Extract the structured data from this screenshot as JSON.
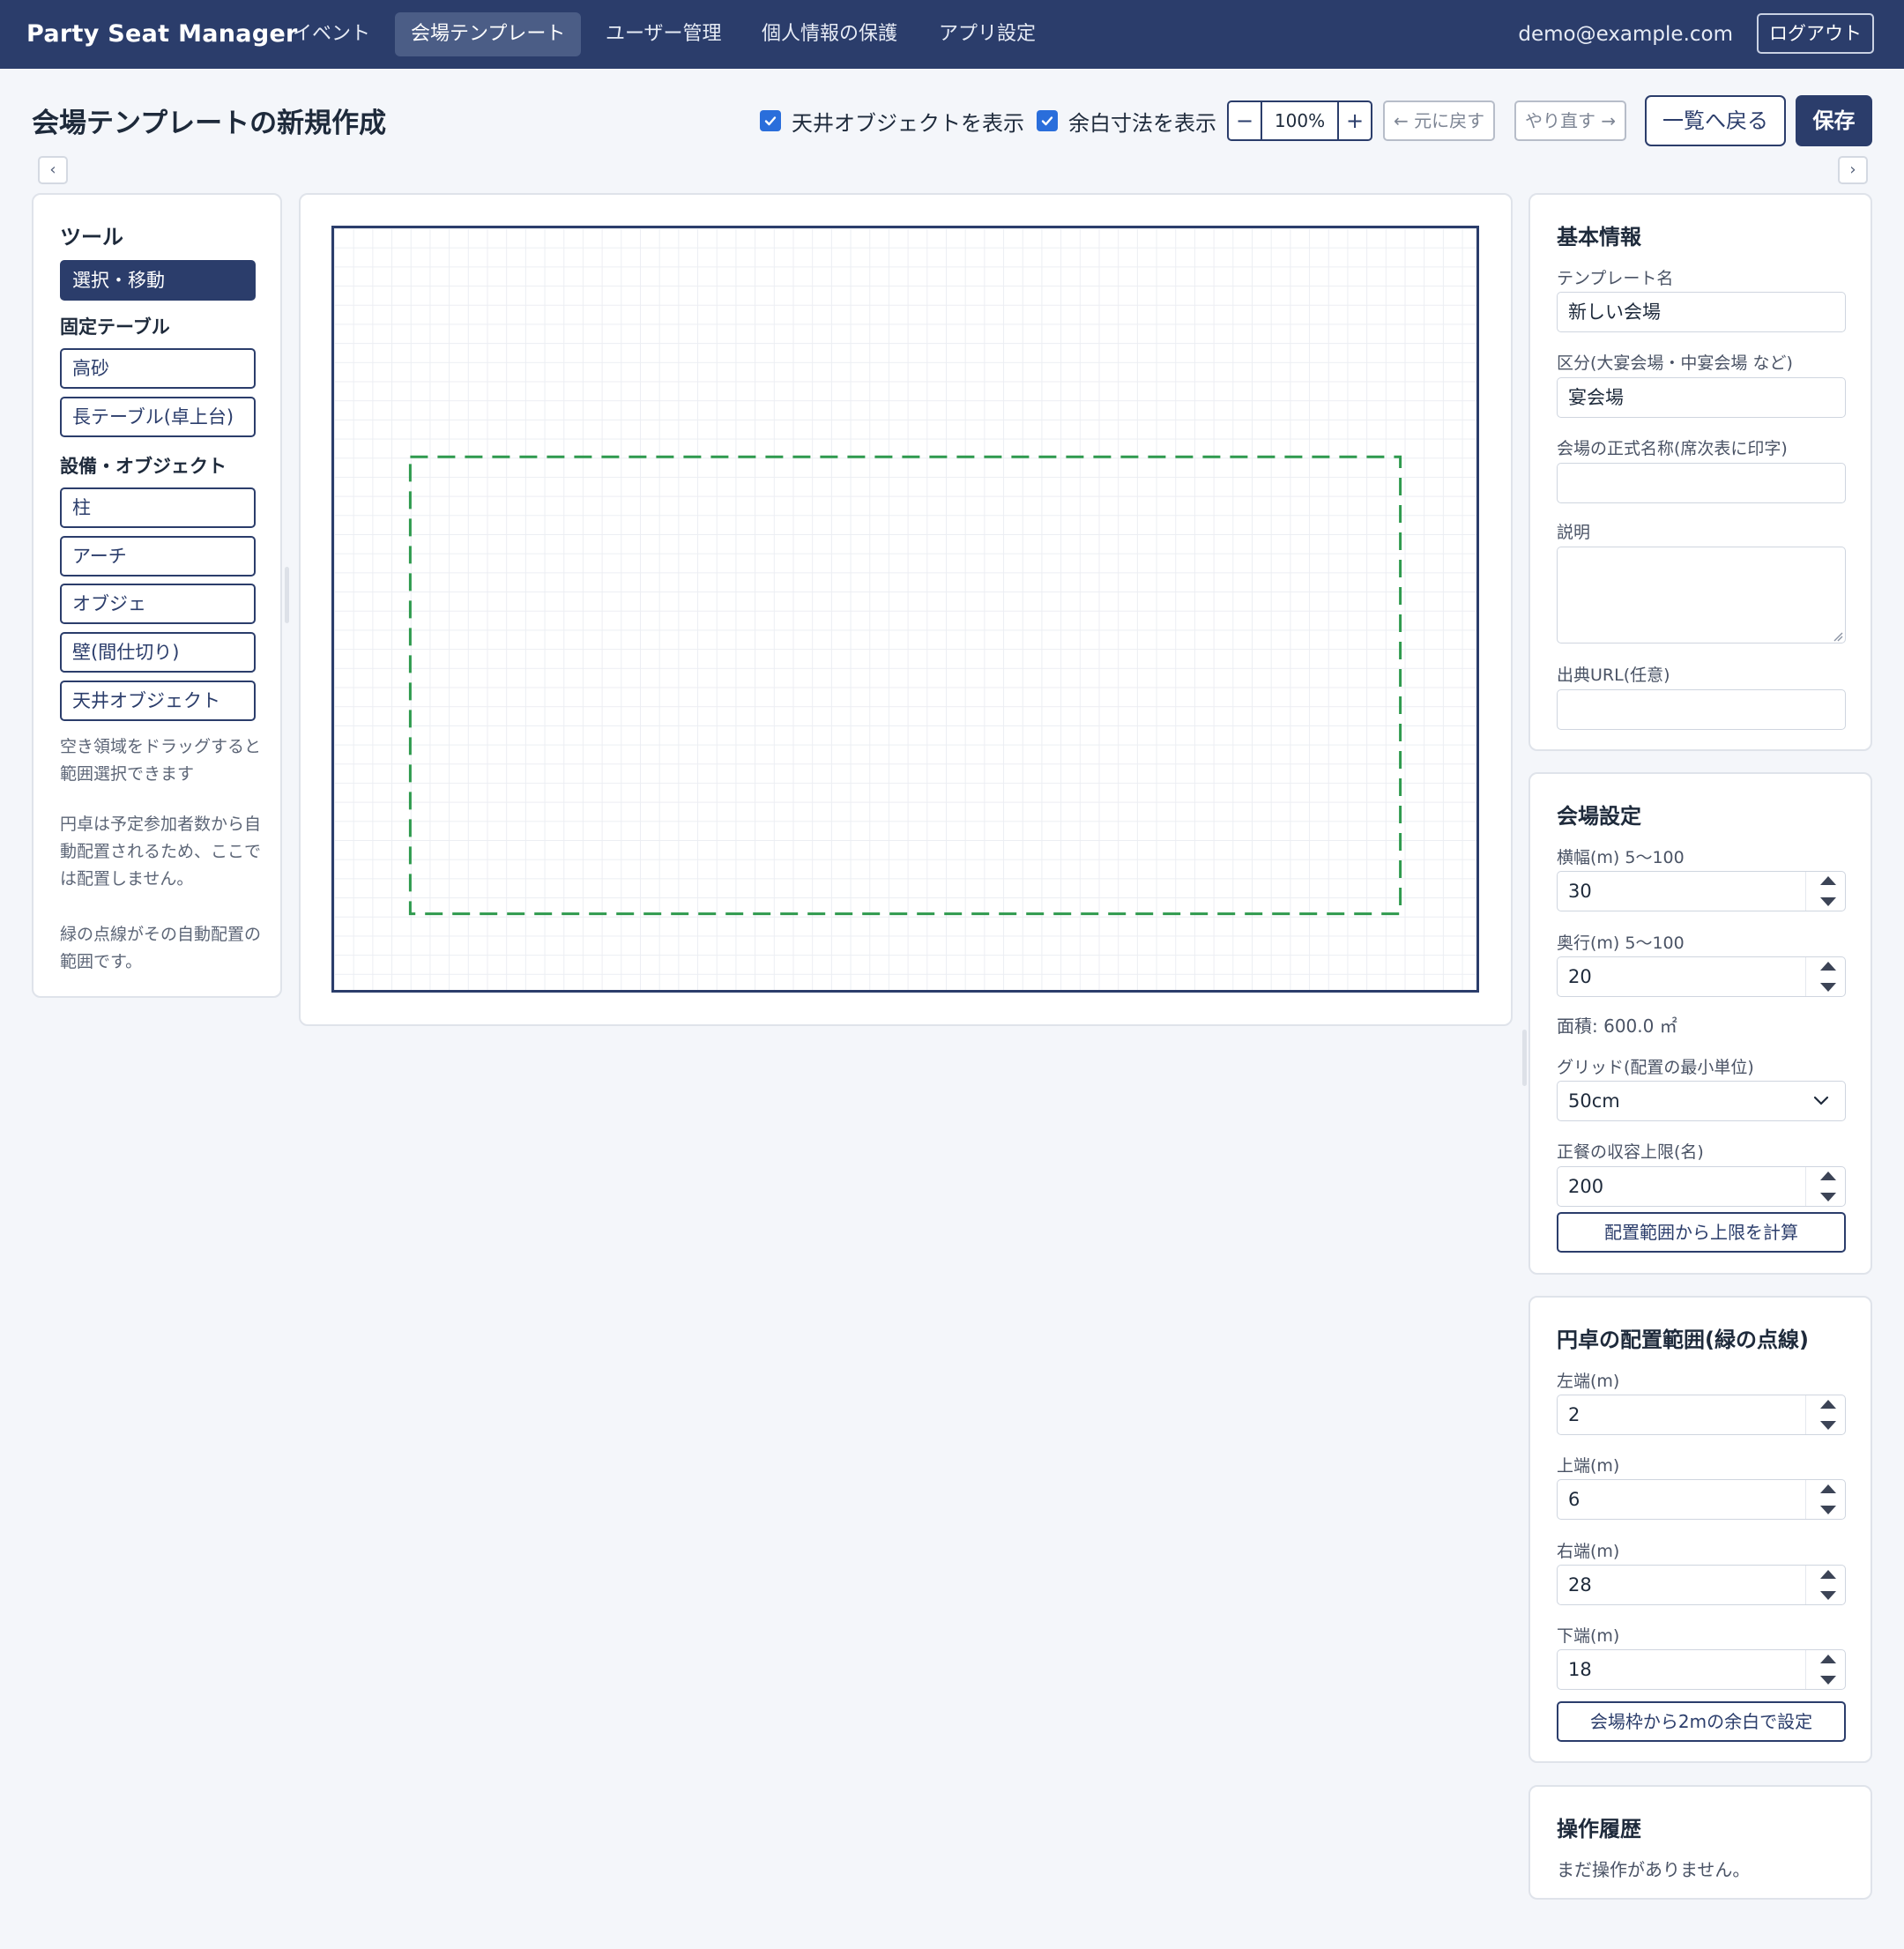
{
  "nav": {
    "brand": "Party Seat Manager",
    "items": [
      {
        "label": "イベント"
      },
      {
        "label": "会場テンプレート"
      },
      {
        "label": "ユーザー管理"
      },
      {
        "label": "個人情報の保護"
      },
      {
        "label": "アプリ設定"
      }
    ],
    "active_index": 1,
    "email": "demo@example.com",
    "logout_label": "ログアウト"
  },
  "header": {
    "title": "会場テンプレートの新規作成",
    "show_ceiling_label": "天井オブジェクトを表示",
    "show_ceiling_checked": true,
    "show_margin_label": "余白寸法を表示",
    "show_margin_checked": true,
    "zoom_minus": "−",
    "zoom_value": "100%",
    "zoom_plus": "+",
    "undo_label": "← 元に戻す",
    "redo_label": "やり直す →",
    "back_label": "一覧へ戻る",
    "save_label": "保存",
    "collapse_left": "‹",
    "collapse_right": "›"
  },
  "tools": {
    "title": "ツール",
    "select_label": "選択・移動",
    "fixed_tables_title": "固定テーブル",
    "fixed_tables": [
      "高砂",
      "長テーブル(卓上台)"
    ],
    "objects_title": "設備・オブジェクト",
    "objects": [
      "柱",
      "アーチ",
      "オブジェ",
      "壁(間仕切り)",
      "天井オブジェクト"
    ],
    "help_drag": "空き領域をドラッグすると範囲選択できます",
    "help_round_1": "円卓は予定参加者数から自動配置されるため、ここでは配置しません。",
    "help_round_2": "緑の点線がその自動配置の範囲です。"
  },
  "canvas": {
    "venue_width_m": 30,
    "venue_depth_m": 20,
    "grid_m": 0.5,
    "area": {
      "left_m": 2,
      "top_m": 6,
      "right_m": 28,
      "bottom_m": 18
    },
    "area_color": "#2f9a4e",
    "border_color": "#2b3d6b"
  },
  "basic": {
    "title": "基本情報",
    "template_name_label": "テンプレート名",
    "template_name_value": "新しい会場",
    "category_label": "区分(大宴会場・中宴会場 など)",
    "category_value": "宴会場",
    "official_name_label": "会場の正式名称(席次表に印字)",
    "official_name_value": "",
    "description_label": "説明",
    "description_value": "",
    "source_url_label": "出典URL(任意)",
    "source_url_value": ""
  },
  "venue": {
    "title": "会場設定",
    "width_label": "横幅(m) 5〜100",
    "width_value": "30",
    "depth_label": "奥行(m) 5〜100",
    "depth_value": "20",
    "area_text": "面積: 600.0 ㎡",
    "grid_label": "グリッド(配置の最小単位)",
    "grid_value": "50cm",
    "capacity_label": "正餐の収容上限(名)",
    "capacity_value": "200",
    "calc_button": "配置範囲から上限を計算"
  },
  "range": {
    "title": "円卓の配置範囲(緑の点線)",
    "left_label": "左端(m)",
    "left_value": "2",
    "top_label": "上端(m)",
    "top_value": "6",
    "right_label": "右端(m)",
    "right_value": "28",
    "bottom_label": "下端(m)",
    "bottom_value": "18",
    "auto_button": "会場枠から2mの余白で設定"
  },
  "history": {
    "title": "操作履歴",
    "empty_text": "まだ操作がありません。"
  }
}
